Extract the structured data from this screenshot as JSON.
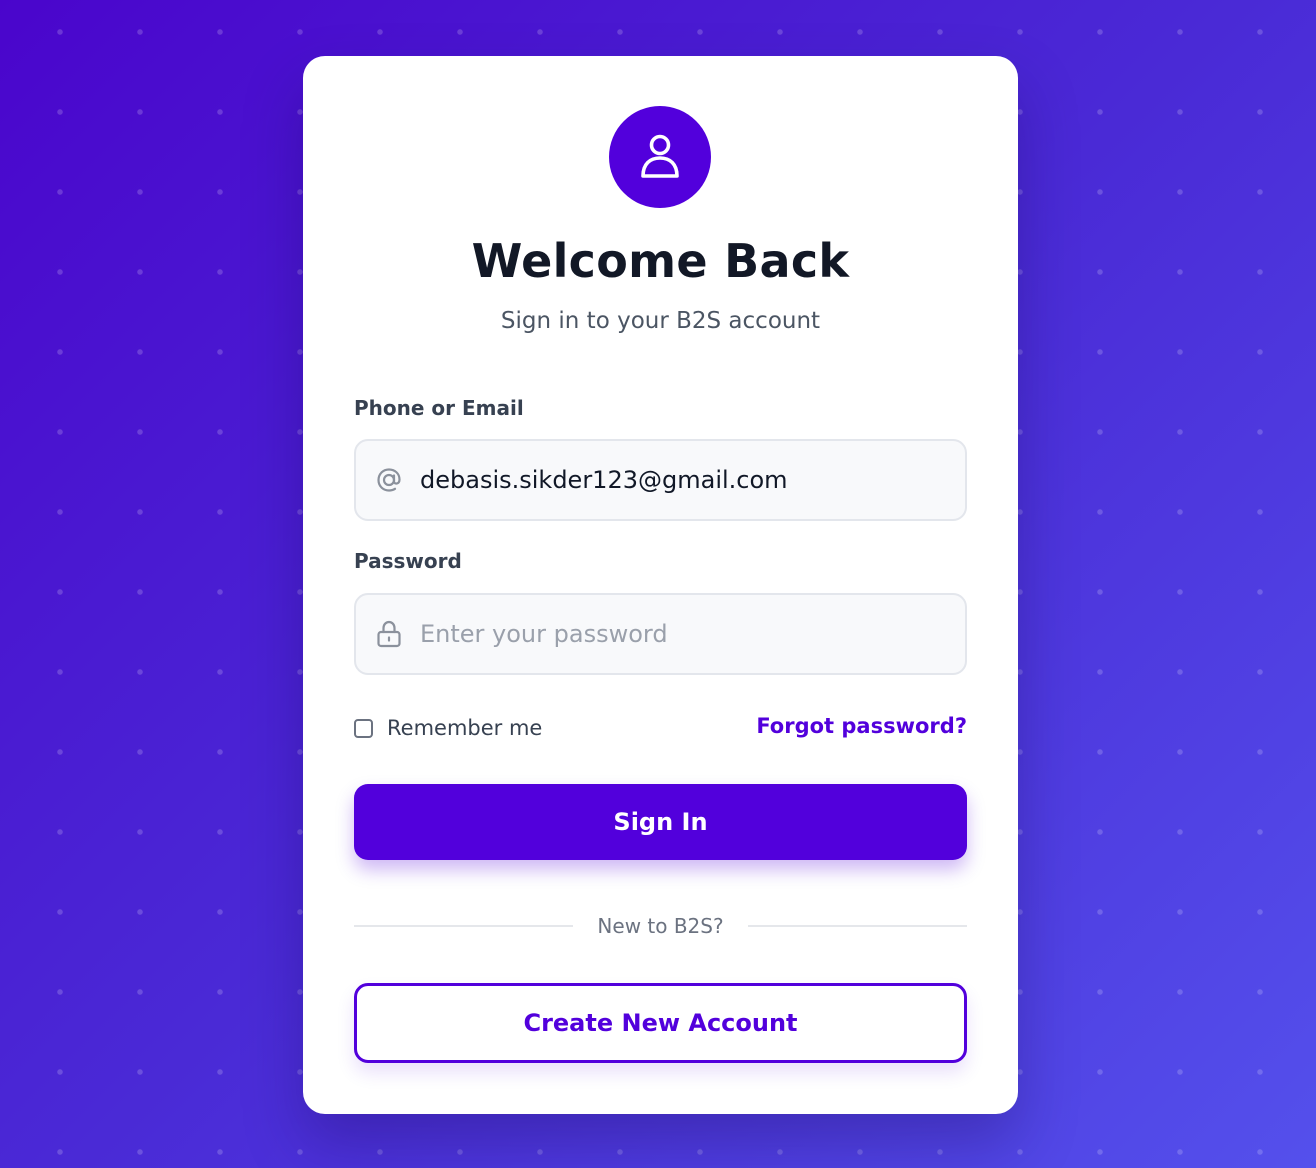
{
  "header": {
    "avatar_icon": "user-icon",
    "title": "Welcome Back",
    "subtitle": "Sign in to your B2S account"
  },
  "form": {
    "identifier": {
      "label": "Phone or Email",
      "value": "debasis.sikder123@gmail.com",
      "placeholder": "",
      "icon": "at-sign-icon"
    },
    "password": {
      "label": "Password",
      "value": "",
      "placeholder": "Enter your password",
      "icon": "lock-icon"
    },
    "remember_label": "Remember me",
    "remember_checked": false,
    "forgot_label": "Forgot password?",
    "signin_label": "Sign In"
  },
  "footer": {
    "divider_text": "New to B2S?",
    "create_label": "Create New Account"
  },
  "colors": {
    "accent": "#5200dc",
    "background_start": "#4a05cc",
    "background_end": "#5450ec",
    "card": "#ffffff"
  }
}
